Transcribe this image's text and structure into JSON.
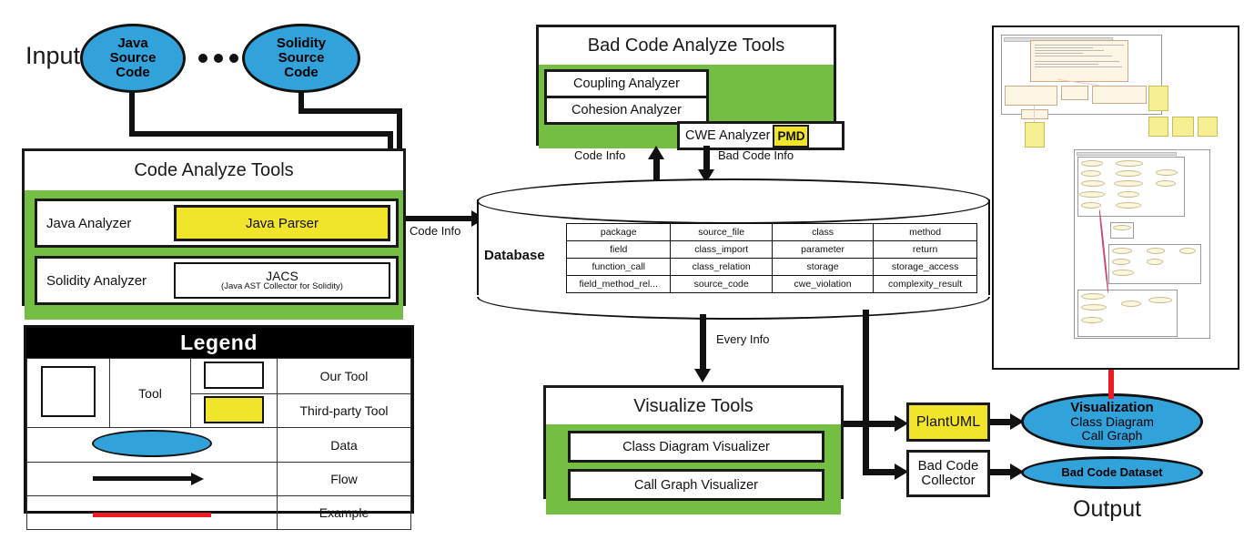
{
  "labels": {
    "input": "Input",
    "output": "Output",
    "database": "Database"
  },
  "input_nodes": [
    {
      "name": "java-source-code",
      "lines": [
        "Java",
        "Source",
        "Code"
      ]
    },
    {
      "name": "solidity-source-code",
      "lines": [
        "Solidity",
        "Source",
        "Code"
      ]
    }
  ],
  "code_analyze_tools": {
    "title": "Code Analyze Tools",
    "rows": [
      {
        "label": "Java Analyzer",
        "tool": "Java Parser",
        "tool_sub": "",
        "third_party": true
      },
      {
        "label": "Solidity Analyzer",
        "tool": "JACS",
        "tool_sub": "(Java AST Collector for Solidity)",
        "third_party": false
      }
    ]
  },
  "bad_code_analyze_tools": {
    "title": "Bad Code Analyze Tools",
    "items": [
      "Coupling Analyzer",
      "Cohesion Analyzer"
    ],
    "cwe": {
      "label": "CWE Analyzer",
      "third_party_label": "PMD"
    }
  },
  "visualize_tools": {
    "title": "Visualize Tools",
    "items": [
      "Class Diagram Visualizer",
      "Call Graph Visualizer"
    ]
  },
  "db_table": [
    [
      "package",
      "source_file",
      "class",
      "method"
    ],
    [
      "field",
      "class_import",
      "parameter",
      "return"
    ],
    [
      "function_call",
      "class_relation",
      "storage",
      "storage_access"
    ],
    [
      "field_method_rel...",
      "source_code",
      "cwe_violation",
      "complexity_result"
    ]
  ],
  "flows": [
    {
      "name": "code-info-to-db",
      "label": "Code Info"
    },
    {
      "name": "code-info-to-bad-code-tools",
      "label": "Code Info"
    },
    {
      "name": "bad-code-info-to-db",
      "label": "Bad Code Info"
    },
    {
      "name": "every-info-to-visualize",
      "label": "Every Info"
    }
  ],
  "output_tools": [
    {
      "name": "plantuml",
      "lines": [
        "PlantUML"
      ],
      "third_party": true
    },
    {
      "name": "bad-code-collector",
      "lines": [
        "Bad Code",
        "Collector"
      ],
      "third_party": false
    }
  ],
  "output_nodes": [
    {
      "name": "visualization",
      "title": "Visualization",
      "lines": [
        "Class Diagram",
        "Call Graph"
      ]
    },
    {
      "name": "bad-code-dataset",
      "title": "Bad Code Dataset",
      "lines": []
    }
  ],
  "legend": {
    "title": "Legend",
    "tool_label": "Tool",
    "rows": [
      {
        "swatch": "white-box",
        "label": "Our Tool"
      },
      {
        "swatch": "yellow-box",
        "label": "Third-party Tool"
      },
      {
        "swatch": "blue-ellipse",
        "label": "Data"
      },
      {
        "swatch": "black-arrow",
        "label": "Flow"
      },
      {
        "swatch": "red-line",
        "label": "Example"
      }
    ]
  },
  "colors": {
    "green": "#74BE43",
    "yellow": "#F1E52B",
    "blue": "#32A2DB",
    "red": "#ED1C24",
    "black": "#111111"
  }
}
